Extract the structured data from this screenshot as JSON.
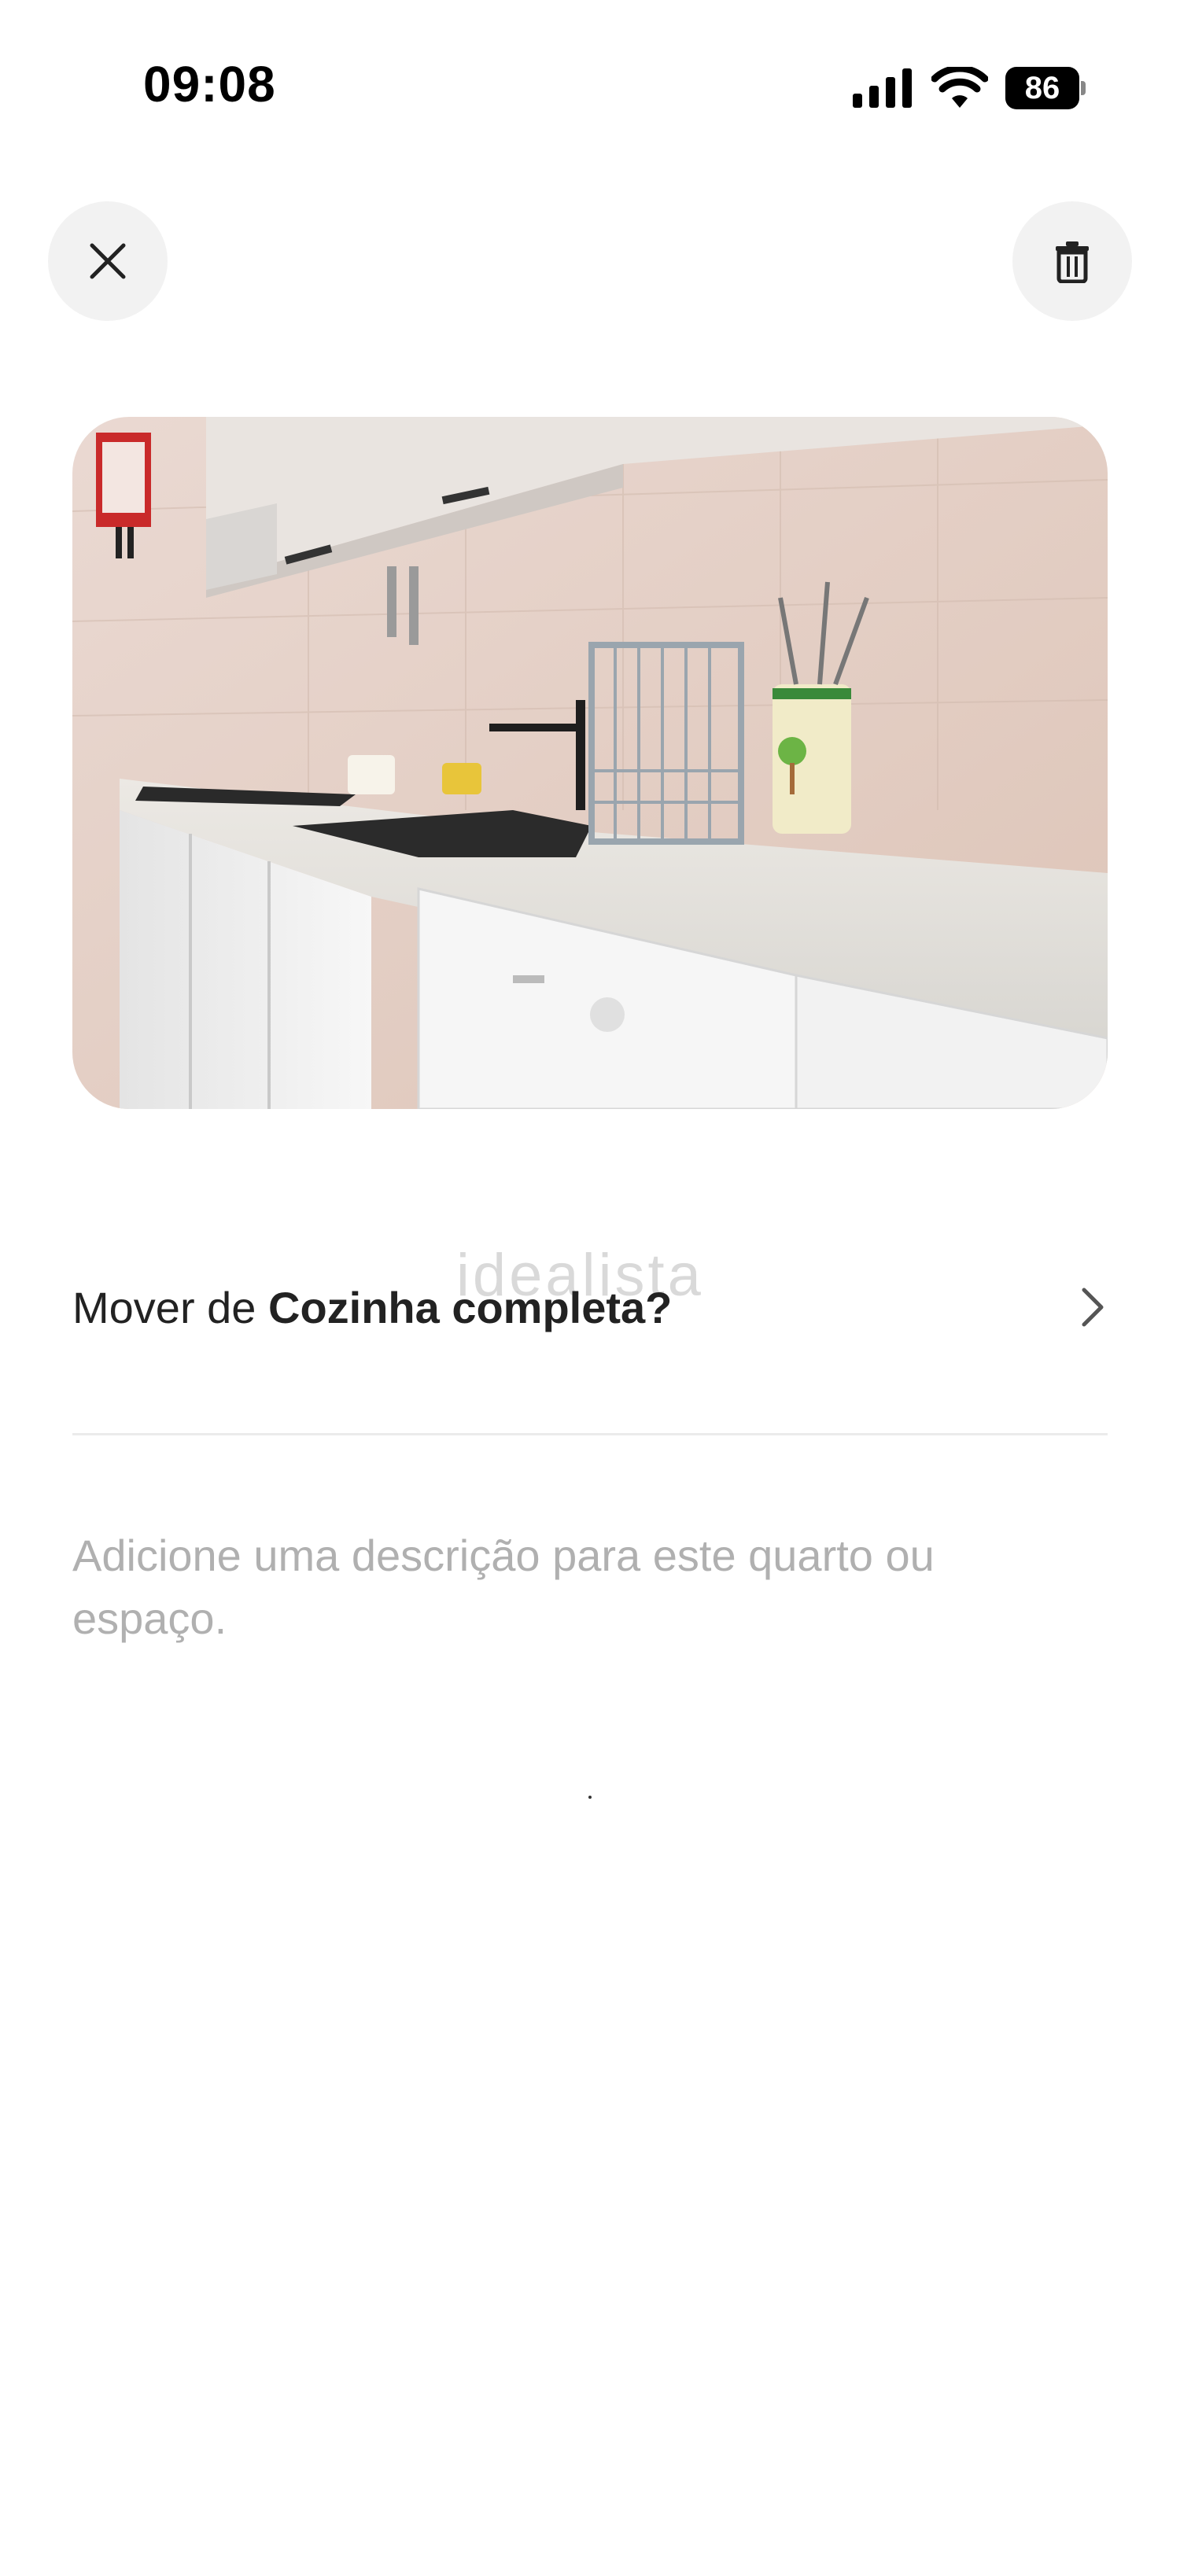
{
  "status_bar": {
    "time": "09:08",
    "battery_level": "86"
  },
  "header": {
    "close_icon": "close-icon",
    "delete_icon": "trash-icon"
  },
  "photo": {
    "subject": "kitchen"
  },
  "watermark": "idealista",
  "move": {
    "prefix": "Mover de ",
    "room": "Cozinha",
    "suffix": " completa?"
  },
  "description": {
    "placeholder": "Adicione uma descrição para este quarto ou espaço."
  },
  "colors": {
    "text": "#222222",
    "placeholder": "#b0b0b0",
    "button_bg": "#f2f2f2",
    "divider": "#ebebeb"
  }
}
